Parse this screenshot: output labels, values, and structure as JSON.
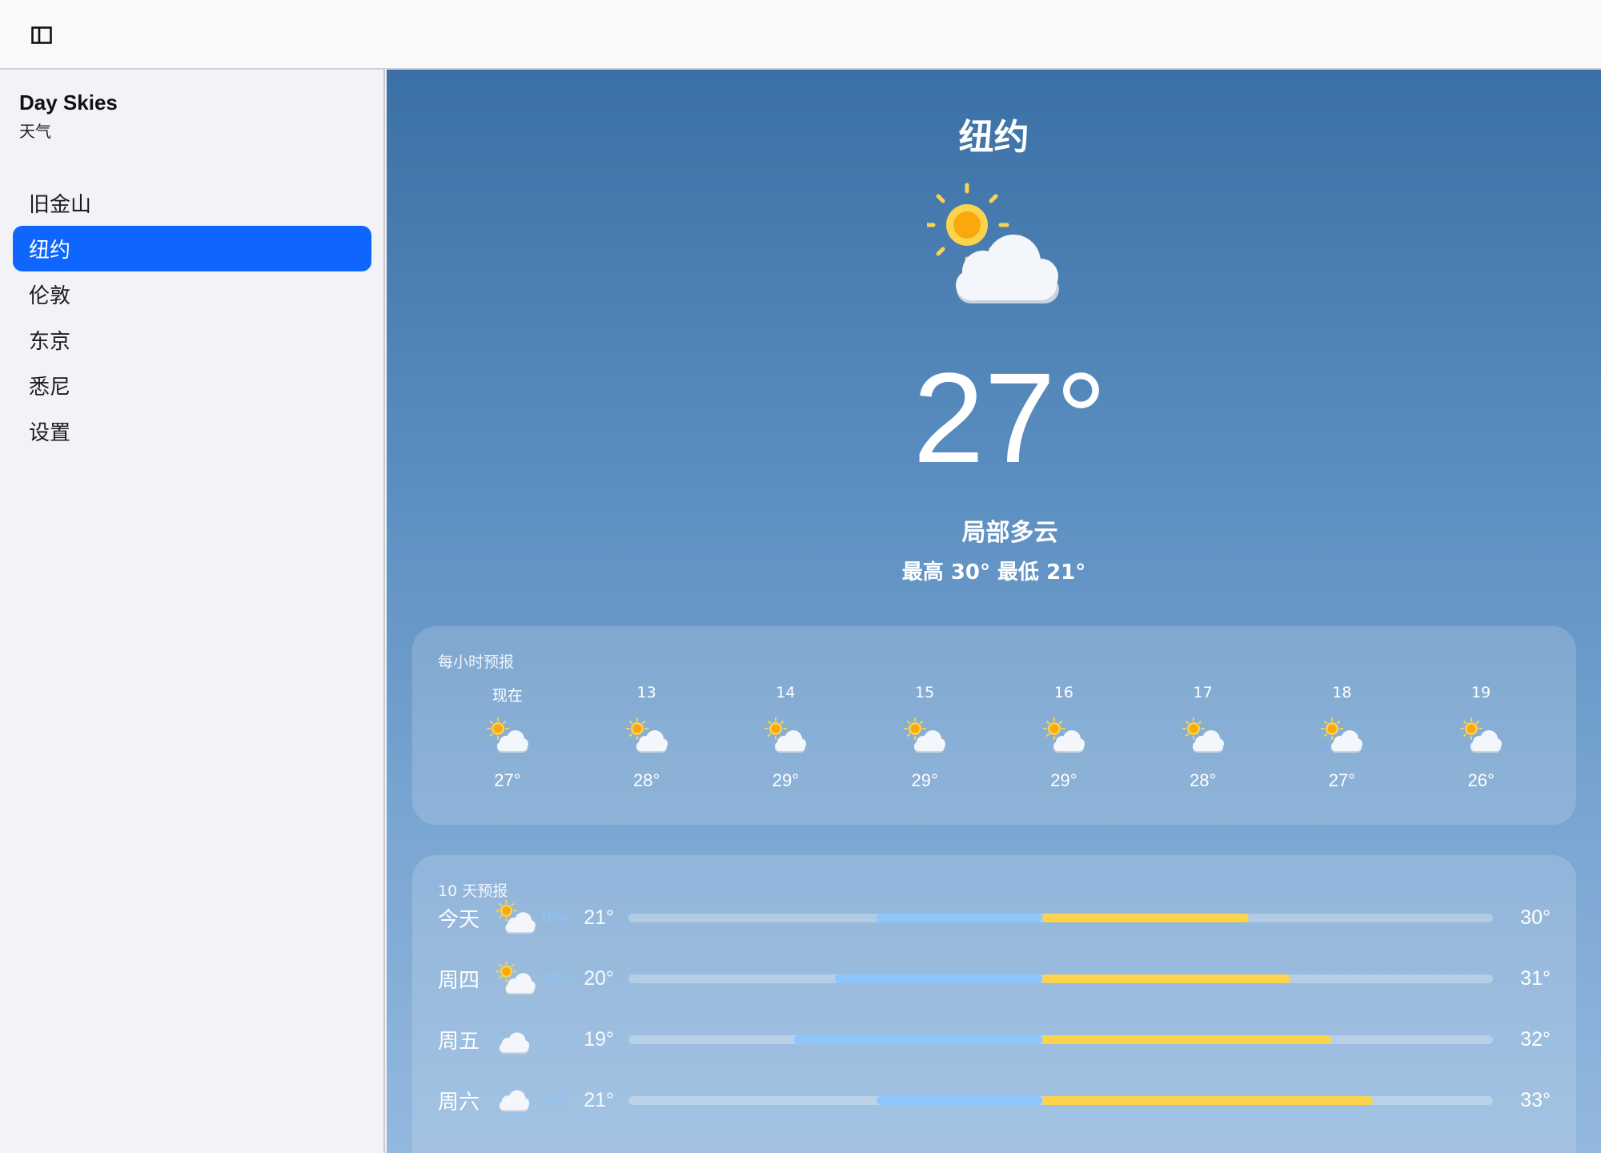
{
  "app": {
    "title": "Day Skies",
    "subtitle": "天气"
  },
  "sidebar": {
    "items": [
      {
        "label": "旧金山",
        "active": false
      },
      {
        "label": "纽约",
        "active": true
      },
      {
        "label": "伦敦",
        "active": false
      },
      {
        "label": "东京",
        "active": false
      },
      {
        "label": "悉尼",
        "active": false
      },
      {
        "label": "设置",
        "active": false
      }
    ]
  },
  "current": {
    "city": "纽约",
    "icon": "partly-cloudy-icon",
    "temperature": "27°",
    "condition": "局部多云",
    "high_low": "最高 30° 最低 21°"
  },
  "hourly": {
    "title": "每小时预报",
    "items": [
      {
        "time": "现在",
        "icon": "partly-cloudy-icon",
        "temp": "27°"
      },
      {
        "time": "13",
        "icon": "partly-cloudy-icon",
        "temp": "28°"
      },
      {
        "time": "14",
        "icon": "partly-cloudy-icon",
        "temp": "29°"
      },
      {
        "time": "15",
        "icon": "partly-cloudy-icon",
        "temp": "29°"
      },
      {
        "time": "16",
        "icon": "partly-cloudy-icon",
        "temp": "29°"
      },
      {
        "time": "17",
        "icon": "partly-cloudy-icon",
        "temp": "28°"
      },
      {
        "time": "18",
        "icon": "partly-cloudy-icon",
        "temp": "27°"
      },
      {
        "time": "19",
        "icon": "partly-cloudy-icon",
        "temp": "26°"
      }
    ]
  },
  "daily": {
    "title": "10 天预报",
    "items": [
      {
        "day": "今天",
        "icon": "partly-cloudy-icon",
        "precip": "10%",
        "low": "21°",
        "high": "30°",
        "range_low": 21,
        "range_high": 30
      },
      {
        "day": "周四",
        "icon": "partly-cloudy-icon",
        "precip": "10%",
        "low": "20°",
        "high": "31°",
        "range_low": 20,
        "range_high": 31
      },
      {
        "day": "周五",
        "icon": "cloudy-icon",
        "precip": "",
        "low": "19°",
        "high": "32°",
        "range_low": 19,
        "range_high": 32
      },
      {
        "day": "周六",
        "icon": "rain-icon",
        "precip": "70%",
        "low": "21°",
        "high": "33°",
        "range_low": 21,
        "range_high": 33
      }
    ]
  },
  "colors": {
    "accent": "#0e66ff",
    "cool_bar": "#8ec5fb",
    "warm_bar": "#fbd34d",
    "sun": "#fbbf24",
    "cloud": "#f3f6fa"
  }
}
